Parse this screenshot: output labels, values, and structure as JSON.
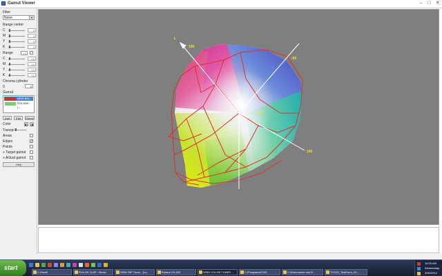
{
  "window": {
    "title": "Gamut Viewer",
    "buttons": [
      "–",
      "□",
      "✕"
    ]
  },
  "sidebar": {
    "filter_label": "Filter",
    "filter_value": "None",
    "range_center_label": "Range center",
    "range_center": [
      {
        "ch": "C",
        "value": "0"
      },
      {
        "ch": "M",
        "value": "0"
      },
      {
        "ch": "Y",
        "value": "0"
      },
      {
        "ch": "K",
        "value": "0"
      }
    ],
    "range_label": "Range",
    "range_all_value": "10",
    "range": [
      {
        "ch": "C",
        "value": "10"
      },
      {
        "ch": "M",
        "value": "10"
      },
      {
        "ch": "Y",
        "value": "10"
      },
      {
        "ch": "K",
        "value": "10"
      }
    ],
    "chroma_label": "Chroma cylinder",
    "chroma_min": "0",
    "chroma_value": "0",
    "gamut_label": "Gamut",
    "gamut_items": [
      {
        "name": "NEW-BAL...",
        "color": "#d4302a",
        "selected": true
      },
      {
        "name": "ROLAND-L...",
        "color": "#7fc77a",
        "selected": false
      }
    ],
    "add_label": "Add",
    "edit_label": "Edit",
    "delete_label": "Delete",
    "color_label": "Color",
    "transp_label": "Transp.",
    "options": [
      {
        "label": "Areas",
        "checked": false
      },
      {
        "label": "Edges",
        "checked": true
      },
      {
        "label": "Points",
        "checked": false
      },
      {
        "label": "+ Target gamut",
        "checked": false
      },
      {
        "label": "+ Actual gamut",
        "checked": false
      }
    ],
    "help_label": "Help"
  },
  "viewport": {
    "axis_labels": [
      {
        "text": "100",
        "role": "a-positive"
      },
      {
        "text": "-90",
        "role": "b-negative"
      },
      {
        "text": "100",
        "role": "b-positive"
      },
      {
        "text": "L",
        "role": "top"
      },
      {
        "text": "50",
        "role": "center"
      }
    ],
    "axis_label_color": "#f0e81a",
    "wire_color": "#e0302a",
    "background": "#7f7f7f"
  },
  "taskbar": {
    "start_label": "start",
    "tasks": [
      "C:\\Hueff",
      "ROLOR CLEP - Brush",
      "GRID RIP Tuner - [Lo...",
      "Roland VS-420",
      "GRID COLOR TUNER ...",
      "C:\\Programs\\CGS...",
      "C:\\Dokumente und E...",
      "T:\\CGS_TestForm_20..."
    ],
    "active_task_index": 4,
    "clock": {
      "time": "10:29 AM",
      "day": "Wednesday",
      "date": "3/30/2012"
    }
  }
}
